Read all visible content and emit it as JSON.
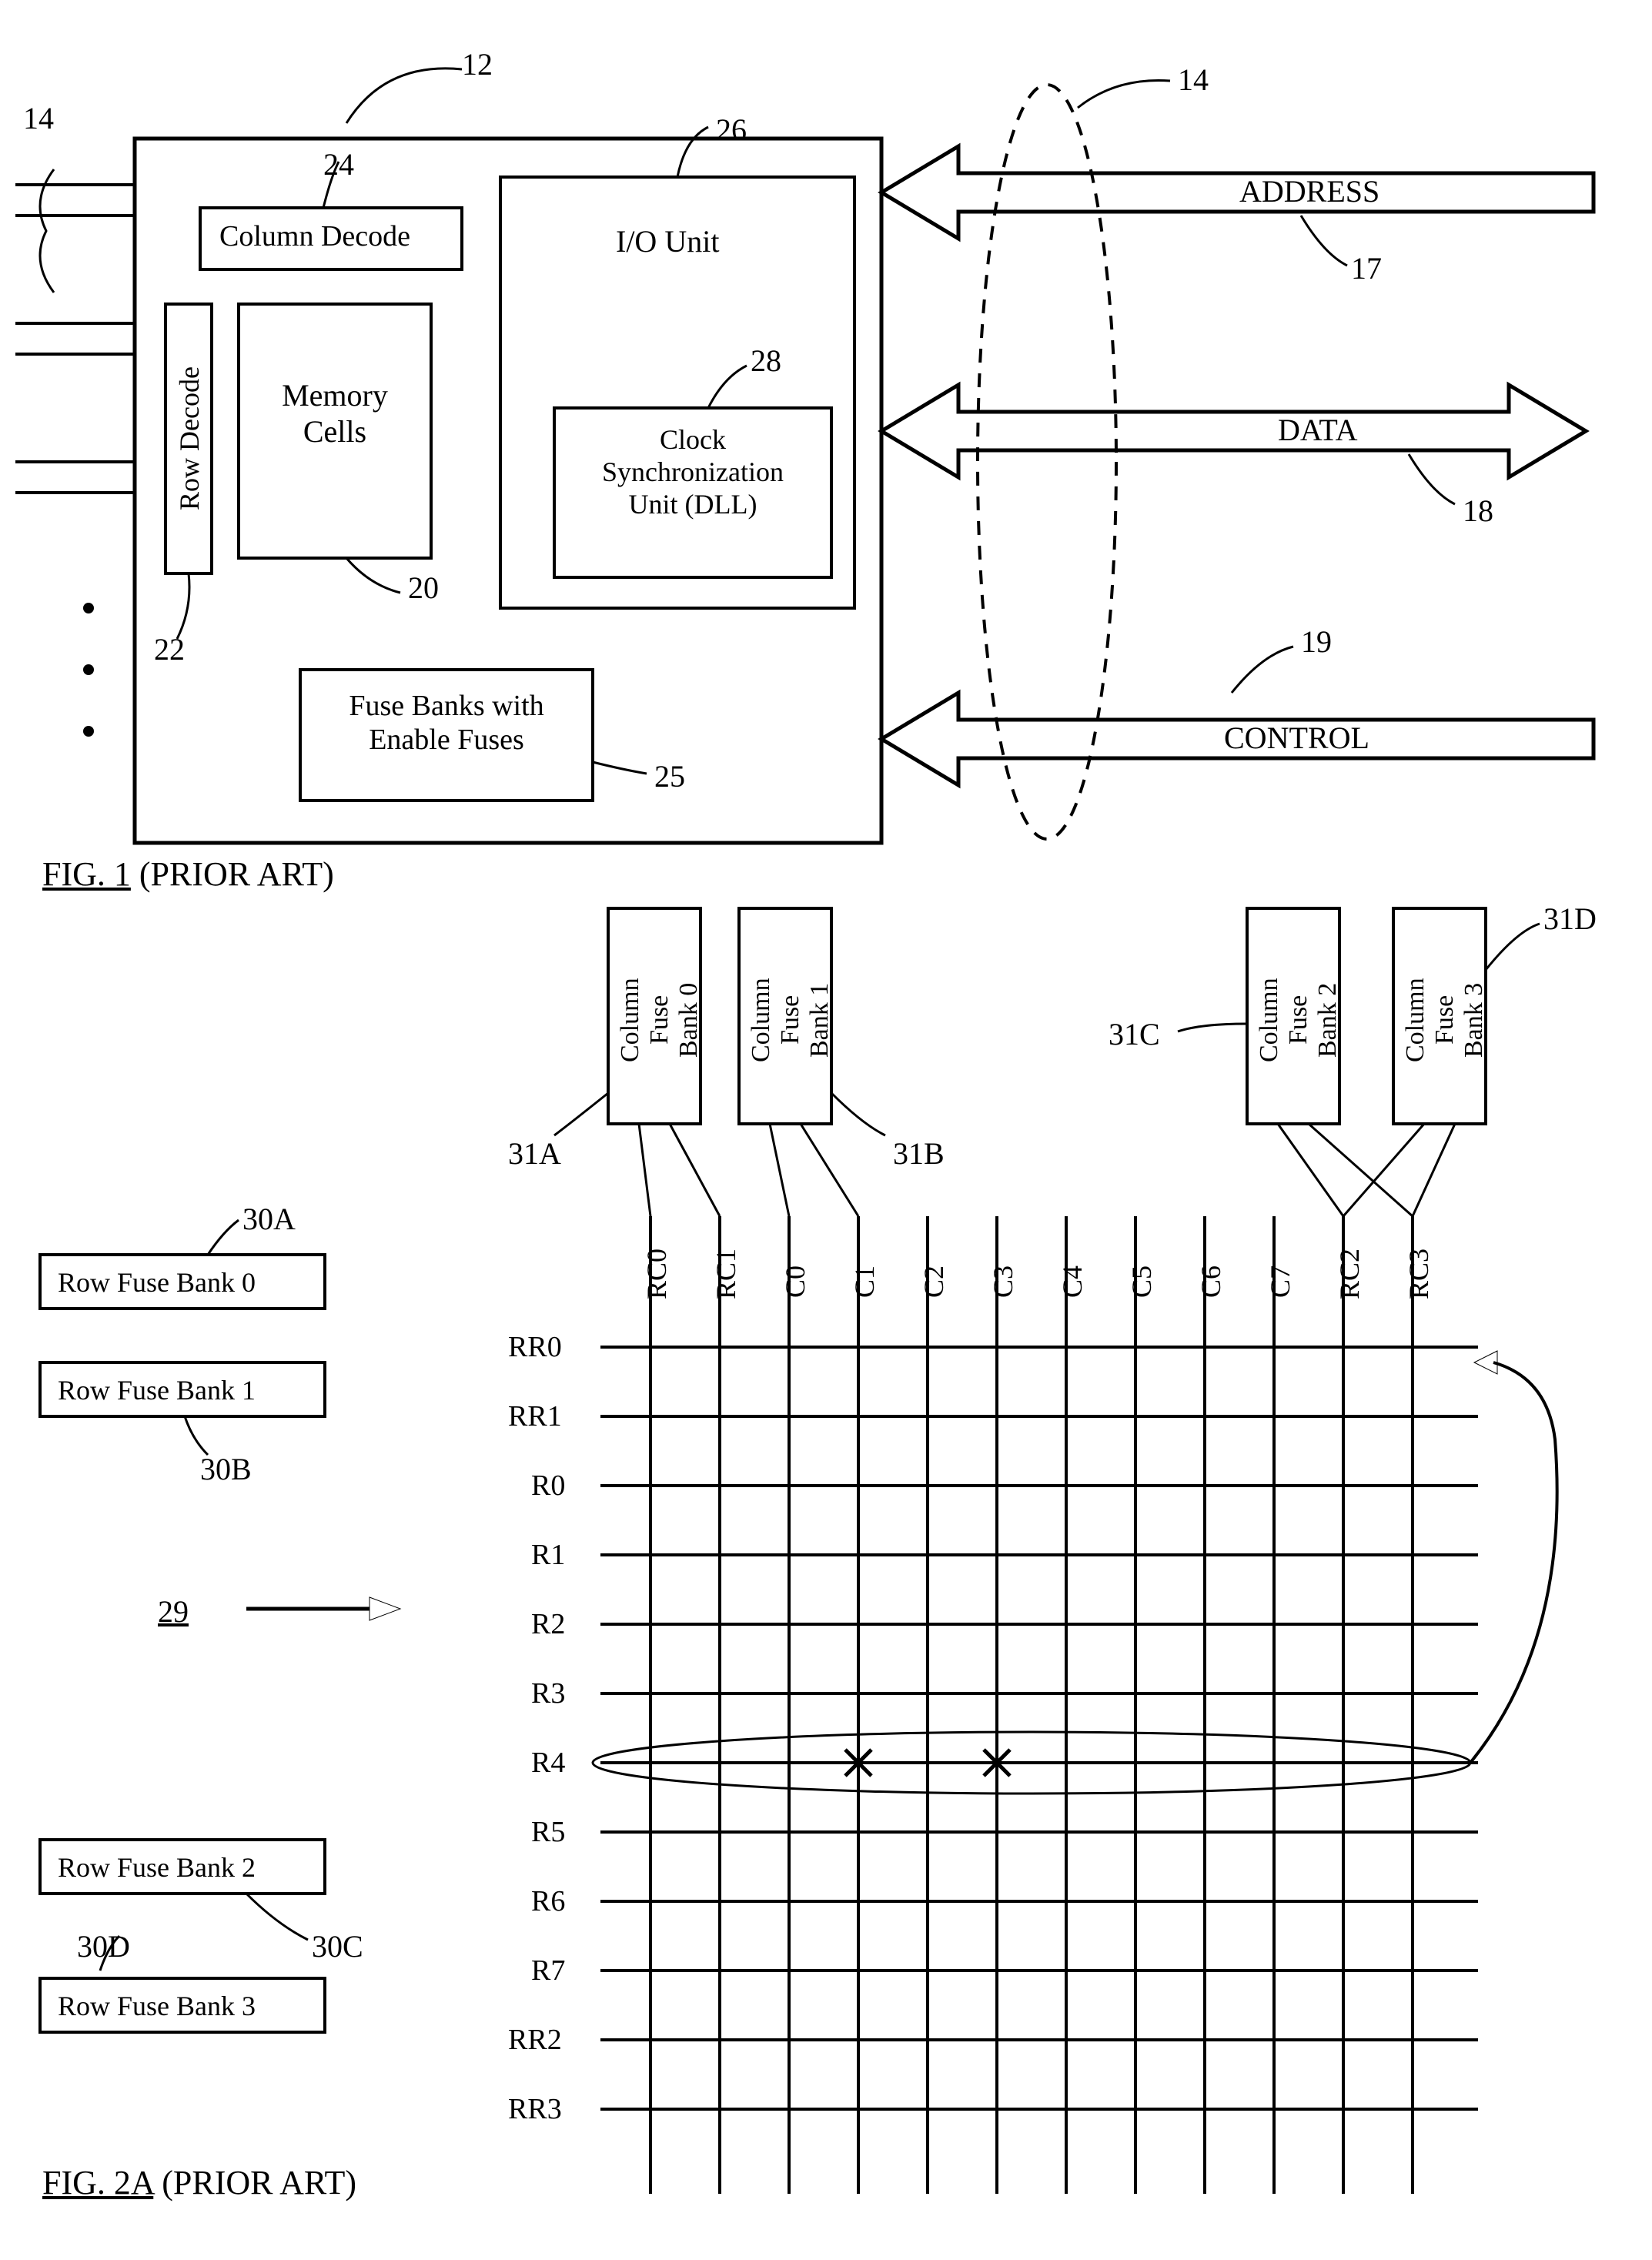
{
  "fig1": {
    "title_underline": "FIG. 1",
    "title_rest": " (PRIOR ART)",
    "ref12": "12",
    "ref14L": "14",
    "ref14R": "14",
    "ref17": "17",
    "ref18": "18",
    "ref19": "19",
    "ref20": "20",
    "ref22": "22",
    "ref24": "24",
    "ref25": "25",
    "ref26": "26",
    "ref28": "28",
    "colDecode": "Column Decode",
    "rowDecode": "Row Decode",
    "memCells": "Memory\nCells",
    "ioUnit": "I/O Unit",
    "clkSync": "Clock\nSynchronization\nUnit (DLL)",
    "fuseBanks": "Fuse Banks with\nEnable Fuses",
    "address": "ADDRESS",
    "data": "DATA",
    "control": "CONTROL"
  },
  "fig2a": {
    "title_underline": "FIG. 2A",
    "title_rest": " (PRIOR ART)",
    "ref29": "29",
    "ref30A": "30A",
    "ref30B": "30B",
    "ref30C": "30C",
    "ref30D": "30D",
    "ref31A": "31A",
    "ref31B": "31B",
    "ref31C": "31C",
    "ref31D": "31D",
    "rowFuse0": "Row Fuse Bank 0",
    "rowFuse1": "Row Fuse Bank 1",
    "rowFuse2": "Row Fuse Bank 2",
    "rowFuse3": "Row Fuse Bank 3",
    "colFuse0": "Column\nFuse\nBank 0",
    "colFuse1": "Column\nFuse\nBank 1",
    "colFuse2": "Column\nFuse\nBank 2",
    "colFuse3": "Column\nFuse\nBank 3",
    "cols": [
      "RC0",
      "RC1",
      "C0",
      "C1",
      "C2",
      "C3",
      "C4",
      "C5",
      "C6",
      "C7",
      "RC2",
      "RC3"
    ],
    "rows": [
      "RR0",
      "RR1",
      "R0",
      "R1",
      "R2",
      "R3",
      "R4",
      "R5",
      "R6",
      "R7",
      "RR2",
      "RR3"
    ]
  }
}
